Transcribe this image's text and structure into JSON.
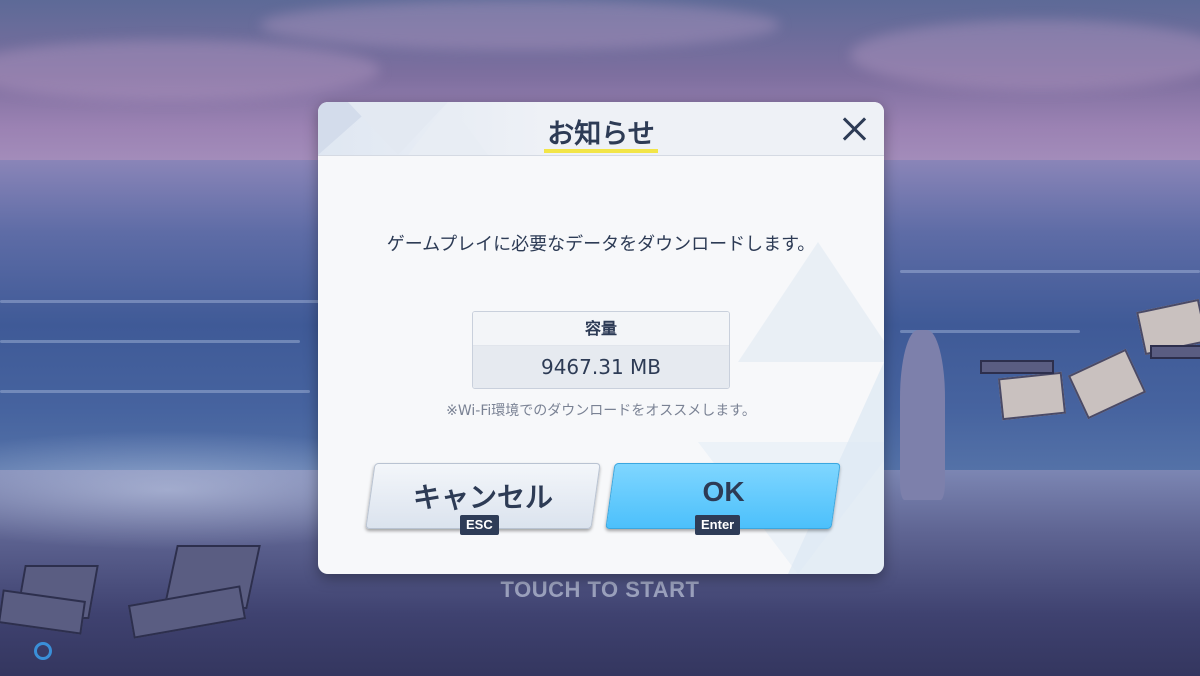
{
  "background": {
    "touch_prompt": "TOUCH TO START"
  },
  "dialog": {
    "title": "お知らせ",
    "message": "ゲームプレイに必要なデータをダウンロードします。",
    "capacity_label": "容量",
    "capacity_value": "9467.31 MB",
    "note": "※Wi-Fi環境でのダウンロードをオススメします。",
    "buttons": {
      "cancel_label": "キャンセル",
      "cancel_key": "ESC",
      "ok_label": "OK",
      "ok_key": "Enter"
    },
    "icons": {
      "close": "close-icon"
    }
  },
  "colors": {
    "accent_ok": "#4cc0fb",
    "title_underline": "#f2e548",
    "text_primary": "#2d3b55"
  }
}
